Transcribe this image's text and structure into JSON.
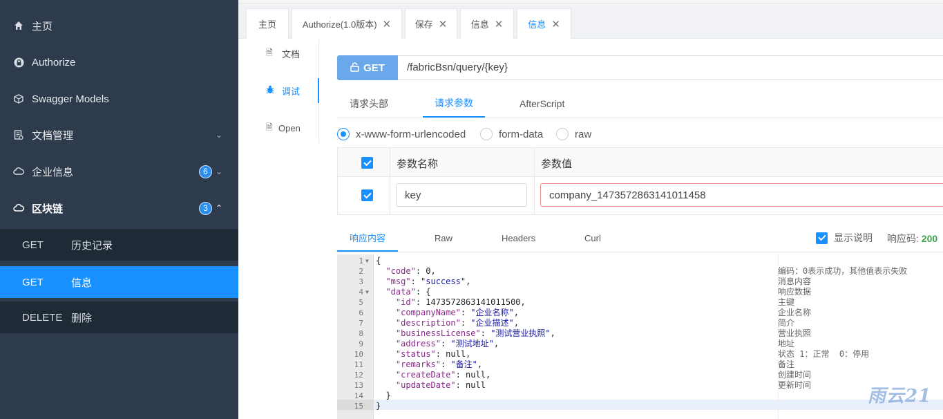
{
  "sidebar": {
    "items": [
      {
        "label": "主页",
        "icon": "home-icon"
      },
      {
        "label": "Authorize",
        "icon": "lock-icon"
      },
      {
        "label": "Swagger Models",
        "icon": "cube-icon"
      },
      {
        "label": "文档管理",
        "icon": "document-icon"
      },
      {
        "label": "企业信息",
        "icon": "cloud-icon",
        "badge": "6"
      },
      {
        "label": "区块链",
        "icon": "cloud-icon",
        "badge": "3"
      }
    ],
    "sub_items": [
      {
        "method": "GET",
        "label": "历史记录"
      },
      {
        "method": "GET",
        "label": "信息"
      },
      {
        "method": "DELETE",
        "label": "删除"
      }
    ]
  },
  "top_tabs": [
    {
      "label": "主页"
    },
    {
      "label": "Authorize(1.0版本)"
    },
    {
      "label": "保存"
    },
    {
      "label": "信息"
    },
    {
      "label": "信息"
    }
  ],
  "doc_nav": [
    {
      "label": "文档"
    },
    {
      "label": "调试"
    },
    {
      "label": "Open"
    }
  ],
  "request": {
    "method": "GET",
    "path": "/fabricBsn/query/{key}",
    "tabs": [
      "请求头部",
      "请求参数",
      "AfterScript"
    ],
    "body_types": [
      "x-www-form-urlencoded",
      "form-data",
      "raw"
    ],
    "table_headers": [
      "参数名称",
      "参数值"
    ],
    "param_name": "key",
    "param_value": "company_1473572863141011458"
  },
  "response": {
    "tabs": [
      "响应内容",
      "Raw",
      "Headers",
      "Curl"
    ],
    "show_desc_label": "显示说明",
    "code_label": "响应码:",
    "code_value": "200",
    "lines": [
      {
        "n": "1",
        "text": "{",
        "desc": ""
      },
      {
        "n": "2",
        "text": "  \"code\": 0,",
        "desc": "编码：0表示成功，其他值表示失败"
      },
      {
        "n": "3",
        "text": "  \"msg\": \"success\",",
        "desc": "消息内容"
      },
      {
        "n": "4",
        "text": "  \"data\": {",
        "desc": "响应数据"
      },
      {
        "n": "5",
        "text": "    \"id\": 1473572863141011500,",
        "desc": "主键"
      },
      {
        "n": "6",
        "text": "    \"companyName\": \"企业名称\",",
        "desc": "企业名称"
      },
      {
        "n": "7",
        "text": "    \"description\": \"企业描述\",",
        "desc": "简介"
      },
      {
        "n": "8",
        "text": "    \"businessLicense\": \"测试营业执照\",",
        "desc": "营业执照"
      },
      {
        "n": "9",
        "text": "    \"address\": \"测试地址\",",
        "desc": "地址"
      },
      {
        "n": "10",
        "text": "    \"status\": null,",
        "desc": "状态 1：正常  0：停用"
      },
      {
        "n": "11",
        "text": "    \"remarks\": \"备注\",",
        "desc": "备注"
      },
      {
        "n": "12",
        "text": "    \"createDate\": null,",
        "desc": "创建时间"
      },
      {
        "n": "13",
        "text": "    \"updateDate\": null",
        "desc": "更新时间"
      },
      {
        "n": "14",
        "text": "  }",
        "desc": ""
      },
      {
        "n": "15",
        "text": "}",
        "desc": ""
      }
    ]
  },
  "watermark": "雨云21",
  "colors": {
    "accent": "#1890ff",
    "sidebar": "#2d3b4d",
    "success": "#3aa34b"
  }
}
